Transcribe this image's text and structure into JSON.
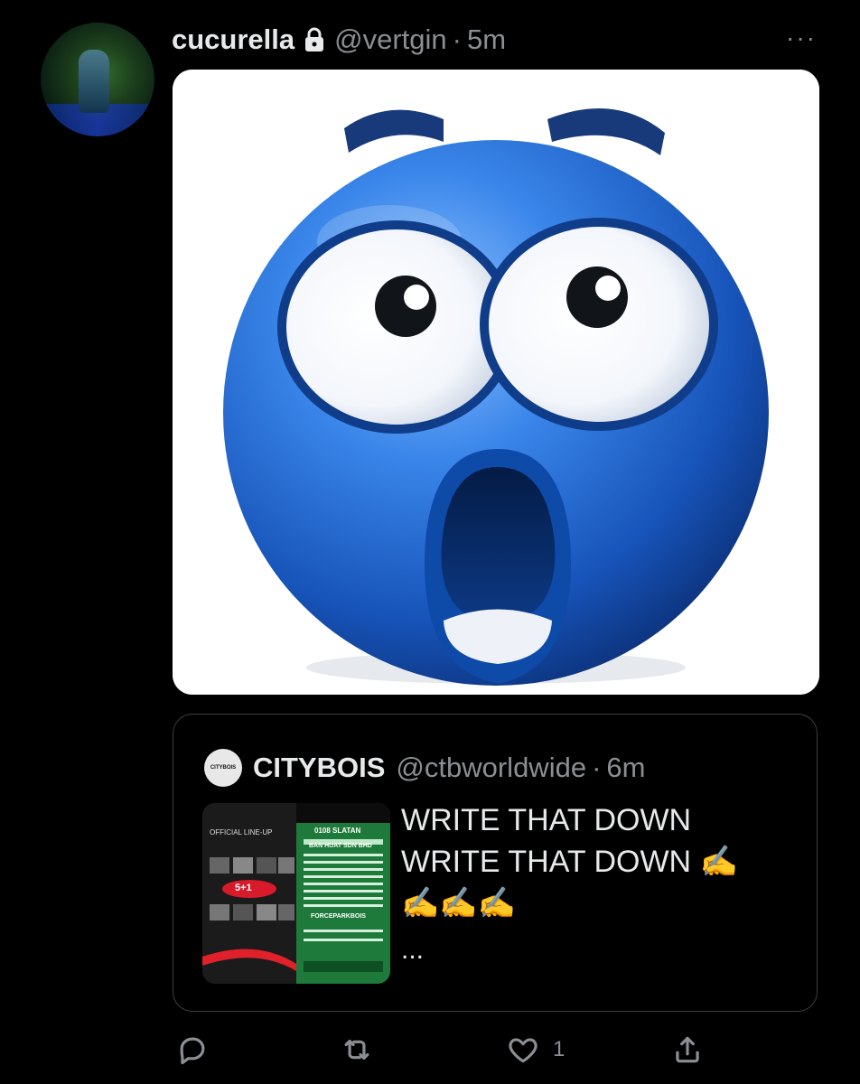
{
  "tweet": {
    "display_name": "cucurella",
    "handle": "@vertgin",
    "separator": "·",
    "time": "5m",
    "more_label": "···"
  },
  "quoted": {
    "logo_text": "CITYBOIS",
    "display_name": "CITYBOIS",
    "handle": "@ctbworldwide",
    "separator": "·",
    "time": "6m",
    "text_line1": "WRITE THAT DOWN",
    "text_line2": "WRITE THAT DOWN ✍️",
    "text_line3": "✍️✍️✍️",
    "ellipsis": "...",
    "thumbnail": {
      "left_label": "OFFICIAL LINE-UP",
      "badge": "5+1",
      "right_title": "0108 SLATAN",
      "right_subtitle": "BAN HUAT SDN BHD",
      "right_act": "FORCEPARKBOIS"
    }
  },
  "actions": {
    "like_count": "1"
  },
  "icons": [
    "lock-icon",
    "more-icon",
    "reply-icon",
    "retweet-icon",
    "like-icon",
    "share-icon"
  ],
  "colors": {
    "background": "#000000",
    "text": "#e7e9ea",
    "secondary": "#8b8f94",
    "border": "#3b3f44",
    "emoji_blue": "#1f63c9"
  }
}
